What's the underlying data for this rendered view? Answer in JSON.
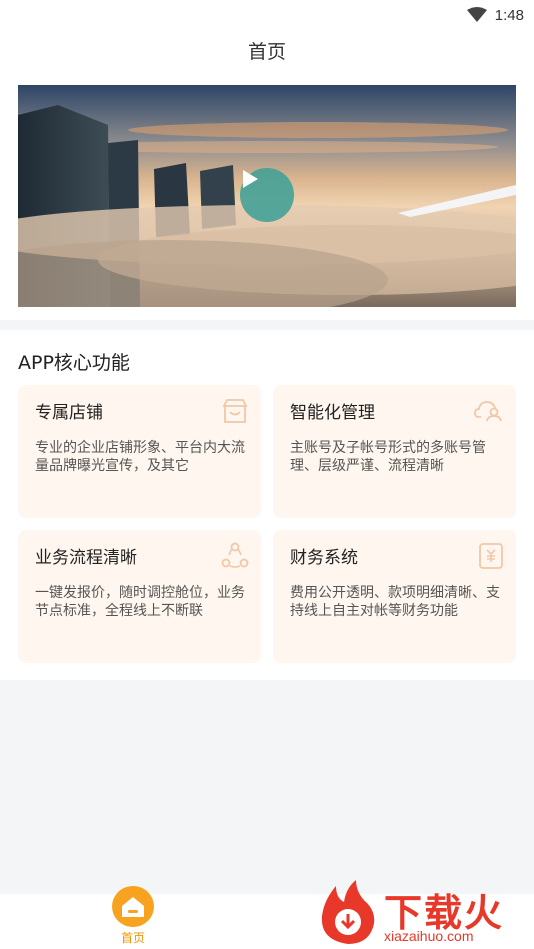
{
  "status_bar": {
    "time": "1:48"
  },
  "header": {
    "title": "首页"
  },
  "section": {
    "title": "APP核心功能"
  },
  "cards": [
    {
      "title": "专属店铺",
      "desc": "专业的企业店铺形象、平台内大流量品牌曝光宣传，及其它",
      "icon": "store-icon"
    },
    {
      "title": "智能化管理",
      "desc": "主账号及子帐号形式的多账号管理、层级严谨、流程清晰",
      "icon": "cloud-user-icon"
    },
    {
      "title": "业务流程清晰",
      "desc": "一键发报价，随时调控舱位，业务节点标准，全程线上不断联",
      "icon": "process-icon"
    },
    {
      "title": "财务系统",
      "desc": "费用公开透明、款项明细清晰、支持线上自主对帐等财务功能",
      "icon": "finance-icon"
    }
  ],
  "tabbar": {
    "home_label": "首页"
  },
  "watermark": {
    "text": "下载火",
    "url": "xiazaihuo.com"
  },
  "colors": {
    "accent": "#f29400",
    "card_bg": "#fff6ef",
    "play": "#40a096",
    "watermark": "#e8382a"
  }
}
